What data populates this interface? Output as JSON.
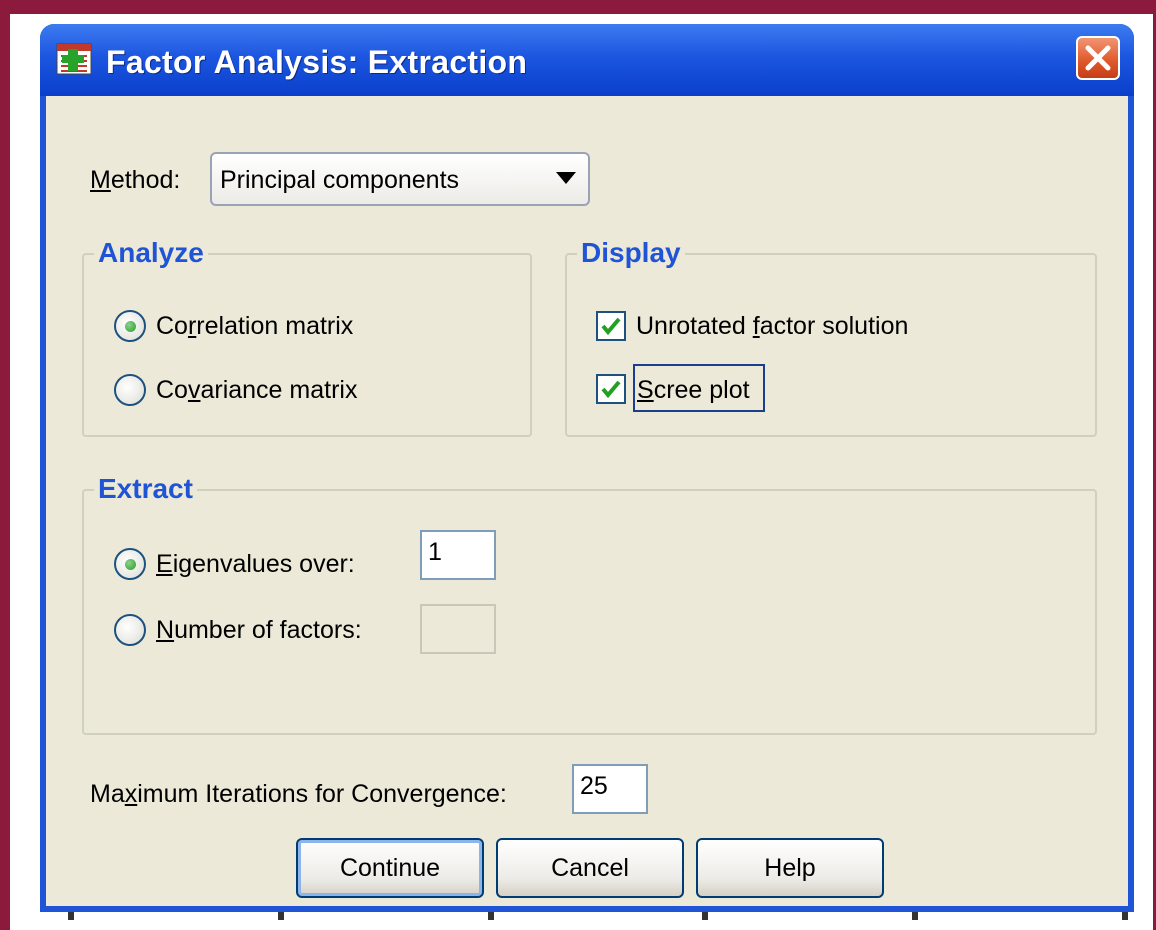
{
  "window": {
    "title": "Factor Analysis: Extraction",
    "icons": {
      "app": "spss-dialog-icon",
      "close": "close-icon"
    }
  },
  "method": {
    "label_ul": "M",
    "label_rest": "ethod:",
    "selected": "Principal components"
  },
  "analyze": {
    "title": "Analyze",
    "correlation": {
      "pre": "Co",
      "ul": "r",
      "post": "relation matrix",
      "selected": true
    },
    "covariance": {
      "pre": "Co",
      "ul": "v",
      "post": "ariance matrix",
      "selected": false
    }
  },
  "display": {
    "title": "Display",
    "unrotated": {
      "pre": "Unrotated ",
      "ul": "f",
      "post": "actor solution",
      "checked": true
    },
    "scree": {
      "pre": "",
      "ul": "S",
      "post": "cree plot",
      "checked": true
    }
  },
  "extract": {
    "title": "Extract",
    "eigen": {
      "ul": "E",
      "post": "igenvalues over:",
      "selected": true,
      "value": "1"
    },
    "nfactors": {
      "ul": "N",
      "post": "umber of factors:",
      "selected": false,
      "value": ""
    }
  },
  "iterations": {
    "pre": "Ma",
    "ul": "x",
    "post": "imum Iterations for Convergence:",
    "value": "25"
  },
  "buttons": {
    "continue": "Continue",
    "cancel": "Cancel",
    "help": "Help"
  },
  "colors": {
    "title_bar": "#1f54d6",
    "group_title": "#1f54d6",
    "dialog_bg": "#ece9d8",
    "frame": "#8c1a3c"
  }
}
